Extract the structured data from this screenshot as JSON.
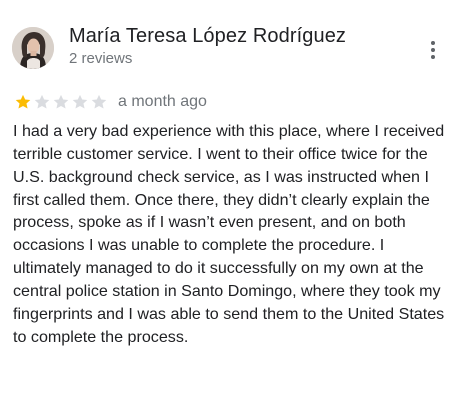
{
  "reviewer": {
    "name": "María Teresa López Rodríguez",
    "reviews_count": "2 reviews",
    "avatar_icon": "profile-photo"
  },
  "review": {
    "rating": 1,
    "max_rating": 5,
    "star_filled_color": "#fbbc04",
    "star_empty_color": "#dadce0",
    "date": "a month ago",
    "text": "I had a very bad experience with this place, where I received terrible customer service. I went to their office twice for the U.S. background check service, as I was instructed when I first called them. Once there, they didn’t clearly explain the process, spoke as if I wasn’t even present, and on both occasions I was unable to complete the procedure. I ultimately managed to do it successfully on my own at the central police station in Santo Domingo, where they took my fingerprints and I was able to send them to the United States to complete the process."
  },
  "menu_icon": "more-vertical-icon"
}
